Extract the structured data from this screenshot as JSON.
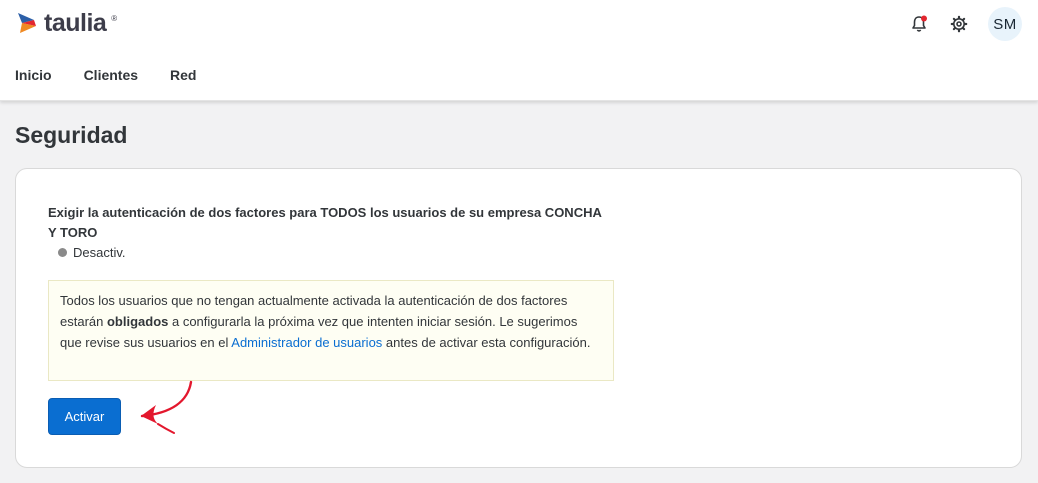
{
  "header": {
    "logo_text": "taulia",
    "logo_mark": "®",
    "avatar_initials": "SM",
    "colors": {
      "logo_blue": "#2c5fa8",
      "logo_orange": "#f08a24",
      "notification_dot": "#e3262f"
    }
  },
  "nav": {
    "items": [
      {
        "label": "Inicio"
      },
      {
        "label": "Clientes"
      },
      {
        "label": "Red"
      }
    ]
  },
  "page": {
    "title": "Seguridad"
  },
  "card": {
    "heading": "Exigir la autenticación de dos factores para TODOS los usuarios de su empresa CONCHA Y TORO",
    "status_label": "Desactiv.",
    "notice": {
      "part1": "Todos los usuarios que no tengan actualmente activada la autenticación de dos factores estarán ",
      "bold": "obligados",
      "part2": " a configurarla la próxima vez que intenten iniciar sesión. Le sugerimos que revise sus usuarios en el ",
      "link": "Administrador de usuarios",
      "part3": " antes de activar esta configuración."
    },
    "activate_label": "Activar"
  },
  "colors": {
    "primary": "#0a6ed1",
    "annotation_arrow": "#e3172d",
    "notice_bg": "#fefef3",
    "status_off": "#8a8a8a"
  }
}
